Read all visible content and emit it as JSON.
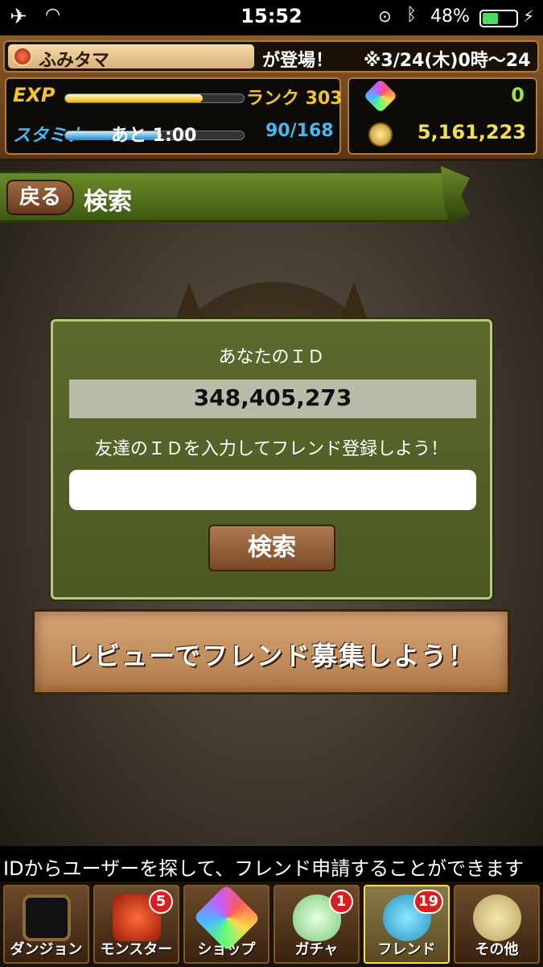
{
  "status_bar": {
    "time": "15:52",
    "battery_percent": "48%",
    "battery_level": 0.48,
    "airplane_icon": "airplane-icon",
    "wifi_icon": "wifi-icon",
    "bluetooth_icon": "bluetooth-icon"
  },
  "header": {
    "news_player": "ふみタマ",
    "news_message": "が登場！",
    "news_date": "※3/24(木)0時～24",
    "exp_label": "EXP",
    "exp_fill": 0.77,
    "rank": "ランク 303",
    "stamina_label": "スタミナ",
    "stamina_remaining": "あと 1:00",
    "stamina_fill": 0.54,
    "stamina_value": "90/168",
    "magic_stones": "0",
    "coins": "5,161,223"
  },
  "page": {
    "back_label": "戻る",
    "title": "検索"
  },
  "dialog": {
    "your_id_label": "あなたのＩＤ",
    "your_id": "348,405,273",
    "hint": "友達のＩＤを入力してフレンド登録しよう！",
    "input_value": "",
    "search_label": "検索"
  },
  "review_banner": "レビューでフレンド募集しよう！",
  "footer_hint": "IDからユーザーを探して、フレンド申請することができます",
  "nav": {
    "dungeon": {
      "label": "ダンジョン"
    },
    "monster": {
      "label": "モンスター",
      "badge": "5"
    },
    "shop": {
      "label": "ショップ"
    },
    "gacha": {
      "label": "ガチャ",
      "badge": "1"
    },
    "friend": {
      "label": "フレンド",
      "badge": "19"
    },
    "other": {
      "label": "その他"
    }
  },
  "colors": {
    "title_bar": "#4e6e1e",
    "dialog_bg": "#52602a",
    "accent_gold": "#f4c430",
    "stamina_blue": "#4ab8f0"
  }
}
